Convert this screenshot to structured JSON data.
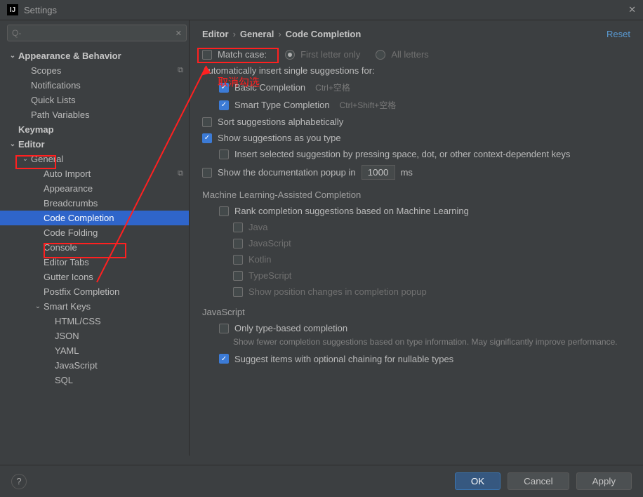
{
  "window": {
    "title": "Settings"
  },
  "search": {
    "placeholder": "Q-"
  },
  "tree": {
    "items": [
      {
        "label": "Appearance & Behavior",
        "level": 0,
        "expanded": true
      },
      {
        "label": "Scopes",
        "level": 1,
        "badge": "⧉"
      },
      {
        "label": "Notifications",
        "level": 1
      },
      {
        "label": "Quick Lists",
        "level": 1
      },
      {
        "label": "Path Variables",
        "level": 1
      },
      {
        "label": "Keymap",
        "level": 0
      },
      {
        "label": "Editor",
        "level": 0,
        "expanded": true,
        "highlight": true
      },
      {
        "label": "General",
        "level": 1,
        "expanded": true
      },
      {
        "label": "Auto Import",
        "level": 2,
        "badge": "⧉"
      },
      {
        "label": "Appearance",
        "level": 2
      },
      {
        "label": "Breadcrumbs",
        "level": 2
      },
      {
        "label": "Code Completion",
        "level": 2,
        "selected": true,
        "highlight": true
      },
      {
        "label": "Code Folding",
        "level": 2
      },
      {
        "label": "Console",
        "level": 2
      },
      {
        "label": "Editor Tabs",
        "level": 2
      },
      {
        "label": "Gutter Icons",
        "level": 2
      },
      {
        "label": "Postfix Completion",
        "level": 2
      },
      {
        "label": "Smart Keys",
        "level": 2,
        "expanded": true
      },
      {
        "label": "HTML/CSS",
        "level": 3
      },
      {
        "label": "JSON",
        "level": 3
      },
      {
        "label": "YAML",
        "level": 3
      },
      {
        "label": "JavaScript",
        "level": 3
      },
      {
        "label": "SQL",
        "level": 3
      }
    ]
  },
  "breadcrumb": {
    "p1": "Editor",
    "p2": "General",
    "p3": "Code Completion",
    "reset": "Reset"
  },
  "options": {
    "match_case": "Match case:",
    "first_letter_only": "First letter only",
    "all_letters": "All letters",
    "auto_insert": "Automatically insert single suggestions for:",
    "basic_completion": "Basic Completion",
    "basic_shortcut": "Ctrl+空格",
    "smart_type": "Smart Type Completion",
    "smart_shortcut": "Ctrl+Shift+空格",
    "sort_alpha": "Sort suggestions alphabetically",
    "show_as_type": "Show suggestions as you type",
    "insert_selected": "Insert selected suggestion by pressing space, dot, or other context-dependent keys",
    "show_doc": "Show the documentation popup in",
    "doc_ms": "1000",
    "ms": "ms",
    "ml_header": "Machine Learning-Assisted Completion",
    "rank_ml": "Rank completion suggestions based on Machine Learning",
    "lang_java": "Java",
    "lang_js": "JavaScript",
    "lang_kotlin": "Kotlin",
    "lang_ts": "TypeScript",
    "show_pos": "Show position changes in completion popup",
    "js_header": "JavaScript",
    "only_type": "Only type-based completion",
    "only_type_help": "Show fewer completion suggestions based on type information. May significantly improve performance.",
    "optional_chain": "Suggest items with optional chaining for nullable types"
  },
  "footer": {
    "ok": "OK",
    "cancel": "Cancel",
    "apply": "Apply"
  },
  "annotation": {
    "text": "取消勾选"
  }
}
